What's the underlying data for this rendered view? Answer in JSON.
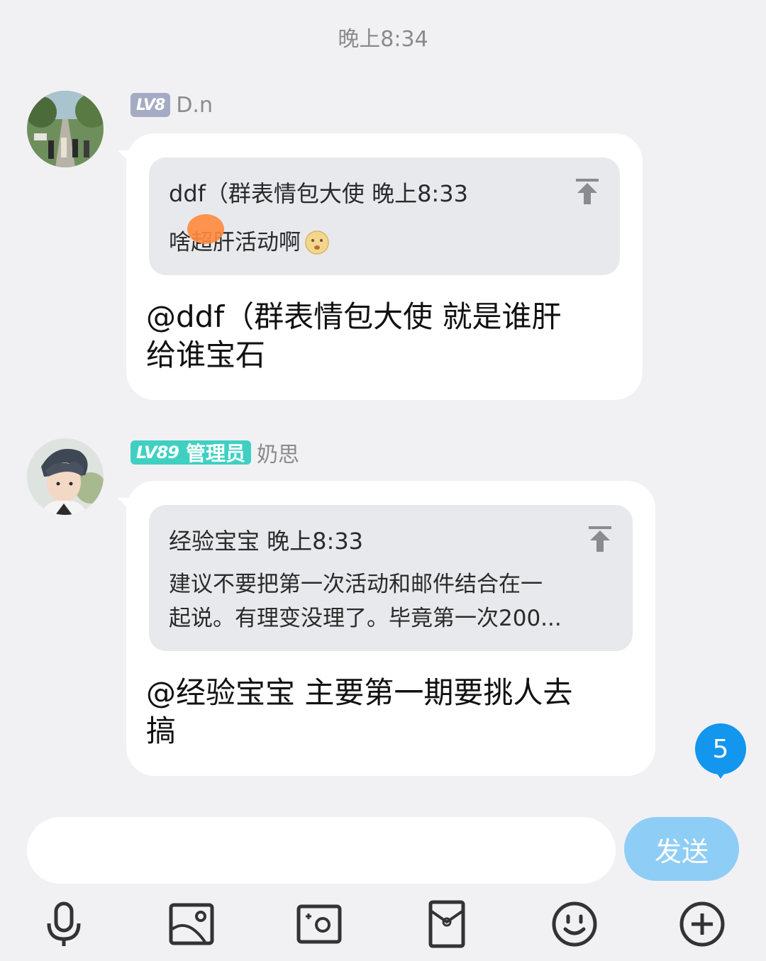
{
  "header": {
    "timestamp": "晚上8:34"
  },
  "messages": [
    {
      "level": "LV8",
      "sender": "D.n",
      "quote": {
        "author_time": "ddf（群表情包大使 晚上8:33",
        "text": "啥超肝活动啊"
      },
      "text_line1": "@ddf（群表情包大使 就是谁肝",
      "text_line2": "给谁宝石"
    },
    {
      "level": "LV89",
      "role": "管理员",
      "sender": "奶思",
      "quote": {
        "author_time": "经验宝宝 晚上8:33",
        "text_line1": "建议不要把第一次活动和邮件结合在一",
        "text_line2": "起说。有理变没理了。毕竟第一次200..."
      },
      "text_line1": "@经验宝宝 主要第一期要挑人去",
      "text_line2": "搞"
    }
  ],
  "unread_count": "5",
  "input": {
    "placeholder": "",
    "send_label": "发送"
  },
  "toolbar": [
    "microphone-icon",
    "image-icon",
    "camera-icon",
    "red-packet-icon",
    "emoji-icon",
    "plus-icon"
  ],
  "colors": {
    "background": "#f1f1f4",
    "bubble": "#ffffff",
    "quote": "#e8e9ec",
    "lv8_badge": "#a5abc4",
    "lv89_badge": "#3fd0c2",
    "unread_badge": "#1296ee",
    "send_button": "#8ecdf6"
  }
}
